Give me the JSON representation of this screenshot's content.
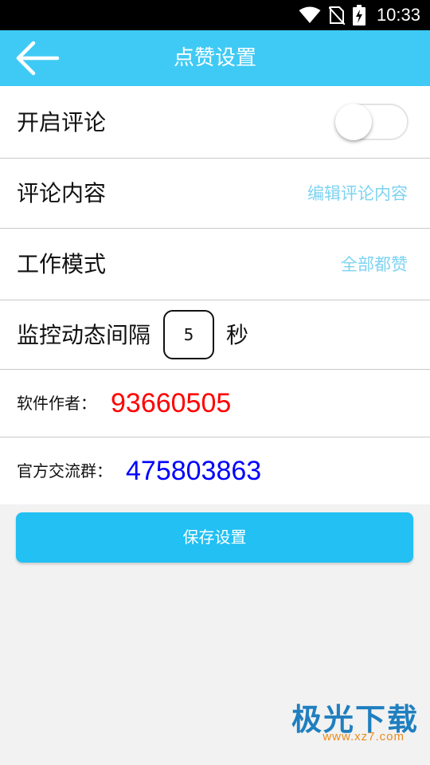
{
  "status_bar": {
    "time": "10:33",
    "icons": [
      "wifi-icon",
      "no-sim-icon",
      "battery-charging-icon"
    ]
  },
  "app_bar": {
    "title": "点赞设置",
    "back_icon": "arrow-left-icon"
  },
  "settings": {
    "enable_comment": {
      "label": "开启评论",
      "enabled": false
    },
    "comment_content": {
      "label": "评论内容",
      "action": "编辑评论内容"
    },
    "work_mode": {
      "label": "工作模式",
      "value": "全部都赞"
    },
    "monitor_interval": {
      "label": "监控动态间隔",
      "value": "5",
      "unit": "秒"
    }
  },
  "info": {
    "author": {
      "label": "软件作者：",
      "value": "93660505",
      "color": "#ff0000"
    },
    "group": {
      "label": "官方交流群：",
      "value": "475803863",
      "color": "#0000ff"
    }
  },
  "save_button": {
    "label": "保存设置"
  },
  "watermark": {
    "text": "极光下载",
    "url": "www.xz7.com"
  },
  "colors": {
    "app_bar": "#3fcaf5",
    "accent_text": "#7dd3f2",
    "button": "#22c0f3",
    "background": "#f2f2f2"
  }
}
